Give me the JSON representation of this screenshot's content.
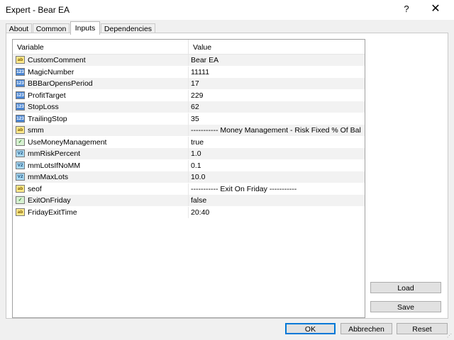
{
  "window": {
    "title": "Expert - Bear EA",
    "help_glyph": "?",
    "close_glyph": "✕"
  },
  "tabs": [
    {
      "label": "About"
    },
    {
      "label": "Common"
    },
    {
      "label": "Inputs",
      "active": true
    },
    {
      "label": "Dependencies"
    }
  ],
  "table": {
    "headers": {
      "variable": "Variable",
      "value": "Value"
    },
    "rows": [
      {
        "type": "ab",
        "icon_label": "ab",
        "name": "CustomComment",
        "value": "Bear EA"
      },
      {
        "type": "123",
        "icon_label": "123",
        "name": "MagicNumber",
        "value": "11111"
      },
      {
        "type": "123",
        "icon_label": "123",
        "name": "BBBarOpensPeriod",
        "value": "17"
      },
      {
        "type": "123",
        "icon_label": "123",
        "name": "ProfitTarget",
        "value": "229"
      },
      {
        "type": "123",
        "icon_label": "123",
        "name": "StopLoss",
        "value": "62"
      },
      {
        "type": "123",
        "icon_label": "123",
        "name": "TrailingStop",
        "value": "35"
      },
      {
        "type": "ab",
        "icon_label": "ab",
        "name": "smm",
        "value": "----------- Money Management - Risk Fixed % Of Bal..."
      },
      {
        "type": "bool",
        "icon_label": "✓",
        "name": "UseMoneyManagement",
        "value": "true"
      },
      {
        "type": "v2",
        "icon_label": "V2",
        "name": "mmRiskPercent",
        "value": "1.0"
      },
      {
        "type": "v2",
        "icon_label": "V2",
        "name": "mmLotsIfNoMM",
        "value": "0.1"
      },
      {
        "type": "v2",
        "icon_label": "V2",
        "name": "mmMaxLots",
        "value": "10.0"
      },
      {
        "type": "ab",
        "icon_label": "ab",
        "name": "seof",
        "value": "----------- Exit On Friday -----------"
      },
      {
        "type": "bool",
        "icon_label": "✓",
        "name": "ExitOnFriday",
        "value": "false"
      },
      {
        "type": "ab",
        "icon_label": "ab",
        "name": "FridayExitTime",
        "value": "20:40"
      }
    ]
  },
  "side_buttons": {
    "load": "Load",
    "save": "Save"
  },
  "footer_buttons": {
    "ok": "OK",
    "cancel": "Abbrechen",
    "reset": "Reset"
  }
}
